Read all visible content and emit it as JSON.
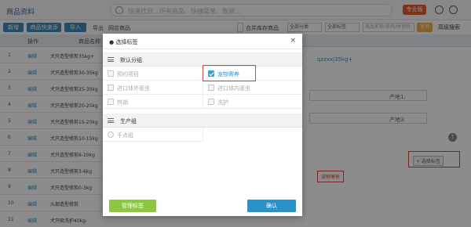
{
  "header": {
    "title": "商品资料",
    "search_placeholder": "快速找到…所有商品、快捷菜单、数据…",
    "pro_badge": "专业版"
  },
  "toolbar": {
    "add_label": "新增",
    "quick_add_label": "商品快速添",
    "import_label": "导入",
    "export_label": "导出",
    "pos_label": "网店商品",
    "stock_checkbox_label": "合并库存商品",
    "category_placeholder": "全部分类",
    "brand_placeholder": "全部标签",
    "search_placeholder": "商品名称/条码/拼音码",
    "query_label": "查询",
    "advanced_label": "高级搜索"
  },
  "table": {
    "headers": [
      "操作",
      "商品名称"
    ],
    "rows": [
      {
        "no": "1",
        "edit": "编辑",
        "name": "犬只造型修剪35kg+"
      },
      {
        "no": "2",
        "edit": "编辑",
        "name": "犬只造型修剪30-35kg"
      },
      {
        "no": "3",
        "edit": "编辑",
        "name": "犬只造型修剪25-30kg"
      },
      {
        "no": "4",
        "edit": "编辑",
        "name": "犬只造型修剪20-25kg"
      },
      {
        "no": "5",
        "edit": "编辑",
        "name": "犬只造型修剪15-20kg"
      },
      {
        "no": "6",
        "edit": "编辑",
        "name": "犬只造型修剪10-15kg"
      },
      {
        "no": "7",
        "edit": "编辑",
        "name": "犬只造型修剪6-10kg"
      },
      {
        "no": "8",
        "edit": "编辑",
        "name": "犬只造型修剪3-6kg"
      },
      {
        "no": "9",
        "edit": "编辑",
        "name": "犬只造型修剪0-3kg"
      },
      {
        "no": "10",
        "edit": "编辑",
        "name": "头部造型修剪"
      },
      {
        "no": "11",
        "edit": "编辑",
        "name": "犬只吸洗护40kg-"
      }
    ]
  },
  "right_panel": {
    "code_value": "qzzxxj35kg+",
    "attr1_label": "产地1:",
    "attr3_label": "产地3:",
    "tag_chip": "宠物寄养",
    "select_tag_button": "+ 选择标签"
  },
  "modal": {
    "title": "● 选择标签",
    "close": "×",
    "group1_label": "默认分组",
    "group1_items": [
      {
        "label": "预约项目",
        "checked": false
      },
      {
        "label": "宠物寄养",
        "checked": true
      },
      {
        "label": "进口体外驱虫",
        "checked": false
      },
      {
        "label": "进口体内驱虫",
        "checked": false
      },
      {
        "label": "热销",
        "checked": false
      },
      {
        "label": "洗护",
        "checked": false
      }
    ],
    "group2_label": "生产组",
    "group2_items": [
      {
        "label": "千点组",
        "checked": false
      }
    ],
    "manage_label": "管理标签",
    "confirm_label": "确认"
  },
  "colors": {
    "primary": "#3c8dbc",
    "green": "#8dc63f",
    "confirm": "#2a91c9",
    "highlight": "#e04040"
  }
}
